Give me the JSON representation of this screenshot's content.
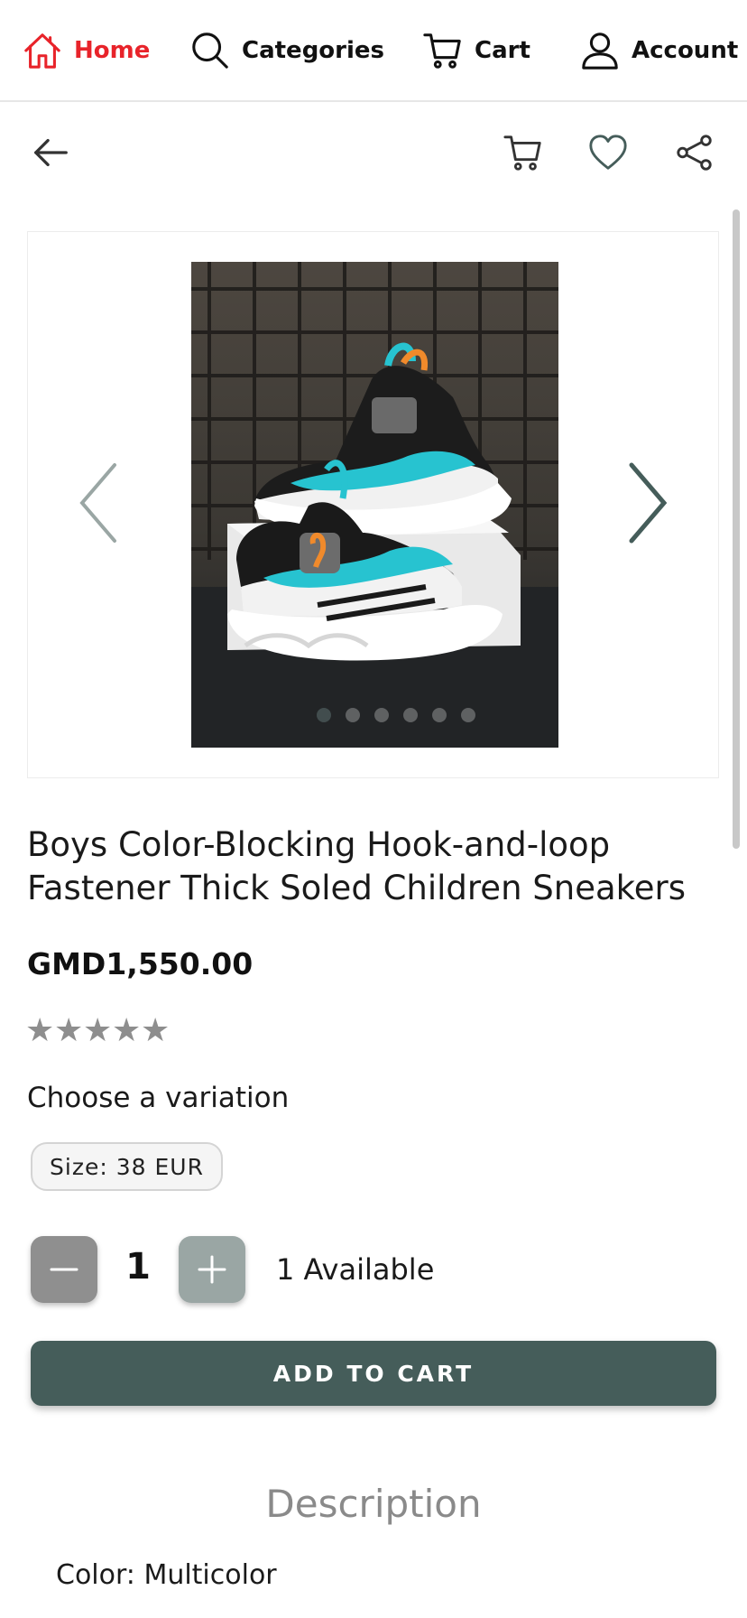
{
  "nav": {
    "home_label": "Home",
    "categories_label": "Categories",
    "cart_label": "Cart",
    "account_label": "Account",
    "active": "home",
    "accent_color": "#e8232a"
  },
  "actions": {
    "icons": [
      "back-arrow-icon",
      "cart-icon",
      "heart-icon",
      "share-icon"
    ]
  },
  "gallery": {
    "image_count": 6,
    "active_index": 0,
    "image_alt": "Boys sneakers product photo"
  },
  "product": {
    "title": "Boys Color-Blocking Hook-and-loop Fastener Thick Soled Children Sneakers",
    "price": "GMD1,550.00",
    "rating": 0,
    "rating_max": 5,
    "choose_variation": "Choose a variation",
    "variation_chip": "Size: 38 EUR",
    "quantity": "1",
    "available": "1 Available",
    "add_to_cart": "ADD TO CART"
  },
  "description": {
    "heading": "Description",
    "color_line": "Color: Multicolor"
  },
  "colors": {
    "primary_button": "#455d5a",
    "star": "#8e8e8e"
  }
}
